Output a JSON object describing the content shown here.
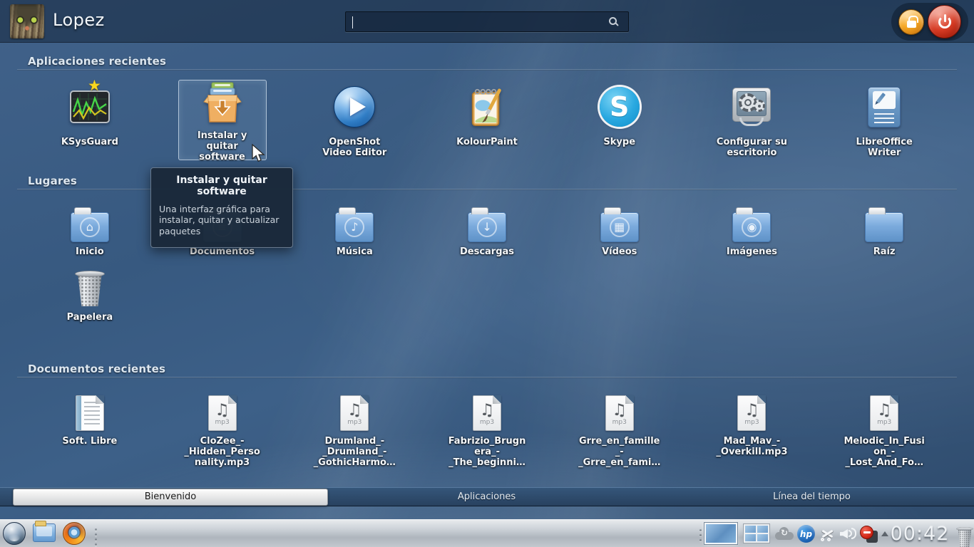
{
  "topbar": {
    "username": "Lopez",
    "search_value": ""
  },
  "tooltip": {
    "title": "Instalar y quitar software",
    "body": "Una interfaz gráfica para instalar, quitar y actualizar paquetes"
  },
  "sections": {
    "recent_apps": {
      "title": "Aplicaciones recientes",
      "items": [
        {
          "label": "KSysGuard",
          "icon": "ksysguard-icon",
          "favorite": true
        },
        {
          "label": "Instalar y\nquitar\nsoftware",
          "icon": "software-installer-icon",
          "highlighted": true
        },
        {
          "label": "OpenShot\nVideo Editor",
          "icon": "openshot-icon"
        },
        {
          "label": "KolourPaint",
          "icon": "kolourpaint-icon"
        },
        {
          "label": "Skype",
          "icon": "skype-icon"
        },
        {
          "label": "Configurar su\nescritorio",
          "icon": "system-settings-icon"
        },
        {
          "label": "LibreOffice\nWriter",
          "icon": "libreoffice-writer-icon"
        }
      ]
    },
    "places": {
      "title": "Lugares",
      "items": [
        {
          "label": "Inicio",
          "icon": "folder-home-icon"
        },
        {
          "label": "Documentos",
          "icon": "folder-documents-icon"
        },
        {
          "label": "Música",
          "icon": "folder-music-icon"
        },
        {
          "label": "Descargas",
          "icon": "folder-downloads-icon"
        },
        {
          "label": "Vídeos",
          "icon": "folder-videos-icon"
        },
        {
          "label": "Imágenes",
          "icon": "folder-images-icon"
        },
        {
          "label": "Raíz",
          "icon": "folder-root-icon"
        },
        {
          "label": "Papelera",
          "icon": "trash-icon"
        }
      ]
    },
    "recent_docs": {
      "title": "Documentos recientes",
      "items": [
        {
          "label": "Soft. Libre",
          "icon": "text-document-icon"
        },
        {
          "label": "CloZee_-\n_Hidden_Perso\nnality.mp3",
          "icon": "mp3-file-icon"
        },
        {
          "label": "Drumland_-\n_Drumland_-\n_GothicHarmo…",
          "icon": "mp3-file-icon"
        },
        {
          "label": "Fabrizio_Brugn\nera_-\n_The_beginni…",
          "icon": "mp3-file-icon"
        },
        {
          "label": "Grre_en_famille\n_-\n_Grre_en_fami…",
          "icon": "mp3-file-icon"
        },
        {
          "label": "Mad_Mav_-\n_Overkill.mp3",
          "icon": "mp3-file-icon"
        },
        {
          "label": "Melodic_In_Fusi\non_-\n_Lost_And_Fo…",
          "icon": "mp3-file-icon"
        }
      ]
    }
  },
  "tabs": [
    {
      "label": "Bienvenido",
      "selected": true
    },
    {
      "label": "Aplicaciones",
      "selected": false
    },
    {
      "label": "Línea del tiempo",
      "selected": false
    }
  ],
  "taskbar": {
    "clock": "00:42",
    "hp_label": "hp",
    "launchers": [
      "kde-menu",
      "file-manager",
      "firefox"
    ],
    "tray": [
      "virtual-desktop-1",
      "virtual-desktop-2",
      "cloud-sync",
      "hp-device",
      "clipboard-scissors",
      "volume",
      "do-not-disturb",
      "expand-tray",
      "trash"
    ]
  },
  "glyphs": {
    "star": "★",
    "home": "⌂",
    "documents": "≡",
    "music": "♪",
    "downloads": "↓",
    "videos": "▦",
    "images": "◉",
    "note": "♫",
    "mp3_badge": "mp3",
    "skype_letter": "S",
    "sync_arrow": "↻"
  },
  "colors": {
    "wallpaper": "#3a5c80",
    "panel": "#c3c9d0",
    "tabbar": "#2d4a68",
    "folder_blue": "#7cabdd",
    "power_red": "#d63b24",
    "lock_orange": "#f5a623",
    "highlight_border": "#c3d4e4"
  }
}
